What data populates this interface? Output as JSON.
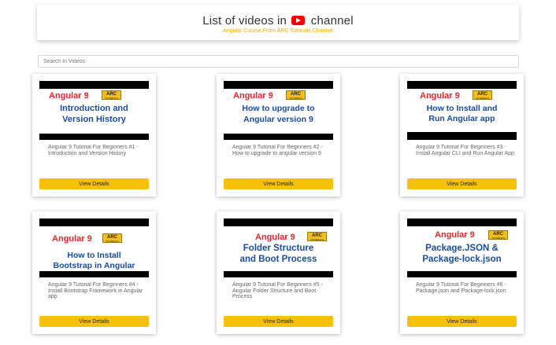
{
  "header": {
    "title_before": "List of videos in",
    "title_after": "channel",
    "subtitle": "Angular Course From ARC Tutorials Channel",
    "icon": "youtube-icon"
  },
  "search": {
    "placeholder": "Search In Videos",
    "value": ""
  },
  "cards": [
    {
      "thumb_brand": "Angular 9",
      "thumb_badge": "ARC",
      "thumb_badge_sub": "TUTORIALS",
      "thumb_lines": [
        "Introduction and",
        "Version History"
      ],
      "description": "Angular 9 Tutorial For Beginners #1 - Introduction and Version History",
      "button_label": "View Details"
    },
    {
      "thumb_brand": "Angular 9",
      "thumb_badge": "ARC",
      "thumb_badge_sub": "TUTORIALS",
      "thumb_lines": [
        "How to upgrade to",
        "Angular version 9"
      ],
      "description": "Angular 9 Tutorial For Beginners #2 - How to upgrade to angular version 9",
      "button_label": "View Details"
    },
    {
      "thumb_brand": "Angular 9",
      "thumb_badge": "ARC",
      "thumb_badge_sub": "TUTORIALS",
      "thumb_lines": [
        "How to Install and",
        "Run Angular app"
      ],
      "description": "Angular 9 Tutorial For Beginners #3 - Install Angular CLI and Run Angular App",
      "button_label": "View Details"
    },
    {
      "thumb_brand": "Angular 9",
      "thumb_badge": "ARC",
      "thumb_badge_sub": "TUTORIALS",
      "thumb_lines": [
        "How to Install",
        "Bootstrap in Angular"
      ],
      "description": "Angular 9 Tutorial For Beginners #4 - Install Bootstrap Framework in Angular app",
      "button_label": "View Details"
    },
    {
      "thumb_brand": "Angular 9",
      "thumb_badge": "ARC",
      "thumb_badge_sub": "TUTORIALS",
      "thumb_lines": [
        "Folder Structure",
        "and Boot Process"
      ],
      "description": "Angular 9 Tutorial For Beginners #5 - Angular Folder Structure and Boot Process",
      "button_label": "View Details"
    },
    {
      "thumb_brand": "Angular 9",
      "thumb_badge": "ARC",
      "thumb_badge_sub": "TUTORIALS",
      "thumb_lines": [
        "Package.JSON &",
        "Package-lock.json"
      ],
      "description": "Angular 9 Tutorial For Beginners #6 - Package.json and Package-lock.json",
      "button_label": "View Details"
    }
  ],
  "colors": {
    "accent": "#f7c00b",
    "subtitle": "#f0a800",
    "thumb_red": "#e8262a",
    "thumb_blue": "#1a4ca0",
    "youtube_red": "#ff0000"
  }
}
